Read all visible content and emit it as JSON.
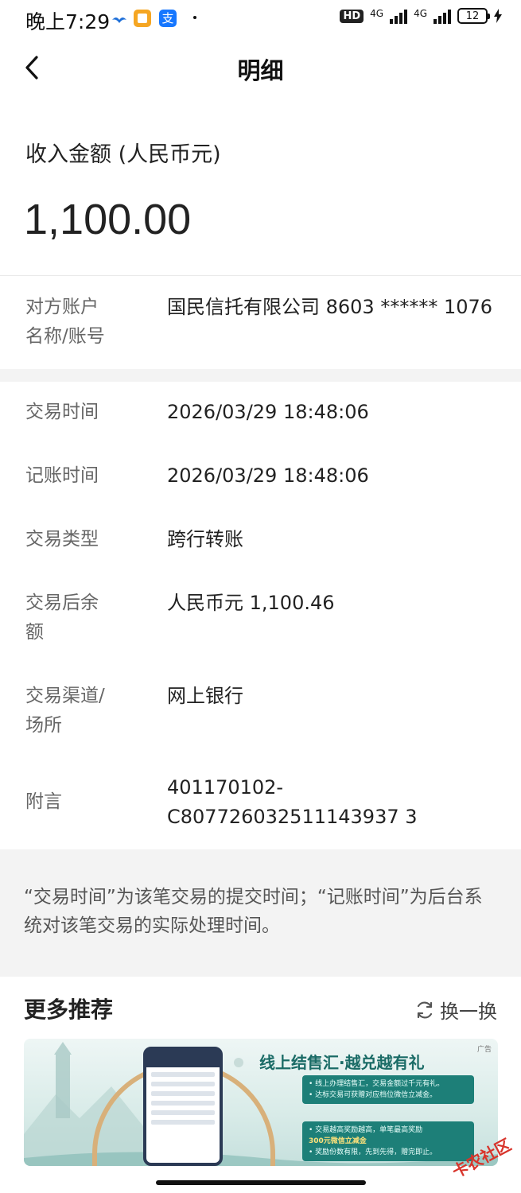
{
  "status_bar": {
    "time": "晚上7:29",
    "network_left": "HD",
    "network_type_1": "4G",
    "network_type_2": "4G",
    "battery": "12"
  },
  "nav": {
    "title": "明细"
  },
  "amount": {
    "label": "收入金额 (人民币元)",
    "value": "1,100.00"
  },
  "counterparty": {
    "label_line1": "对方账户",
    "label_line2": "名称/账号",
    "value": "国民信托有限公司 8603 ****** 1076"
  },
  "details": [
    {
      "label_line1": "交易时间",
      "label_line2": "",
      "value_line1": "2026/03/29 18:48:06",
      "value_line2": ""
    },
    {
      "label_line1": "记账时间",
      "label_line2": "",
      "value_line1": "2026/03/29 18:48:06",
      "value_line2": ""
    },
    {
      "label_line1": "交易类型",
      "label_line2": "",
      "value_line1": "跨行转账",
      "value_line2": ""
    },
    {
      "label_line1": "交易后余",
      "label_line2": "额",
      "value_line1": "人民币元 1,100.46",
      "value_line2": ""
    },
    {
      "label_line1": "交易渠道/",
      "label_line2": "场所",
      "value_line1": "网上银行",
      "value_line2": ""
    },
    {
      "label_line1": "附言",
      "label_line2": "",
      "value_line1": "401170102-",
      "value_line2": "C807726032511143937 3"
    }
  ],
  "note": "“交易时间”为该笔交易的提交时间；“记账时间”为后台系统对该笔交易的实际处理时间。",
  "recommend": {
    "title": "更多推荐",
    "refresh_label": "换一换",
    "banner": {
      "title": "线上结售汇·越兑越有礼",
      "ad_label": "广告",
      "box1_line1": "• 线上办理结售汇，交易金额过千元有礼。",
      "box1_line2": "• 达标交易可获赠对应档位微信立减金。",
      "box2_line1": "• 交易越高奖励越高，单笔最高奖励",
      "box2_line2": "300元微信立减金",
      "box2_line3": "• 奖励份数有限，先到先得，赠完即止。"
    }
  },
  "watermark": "卡农社区"
}
